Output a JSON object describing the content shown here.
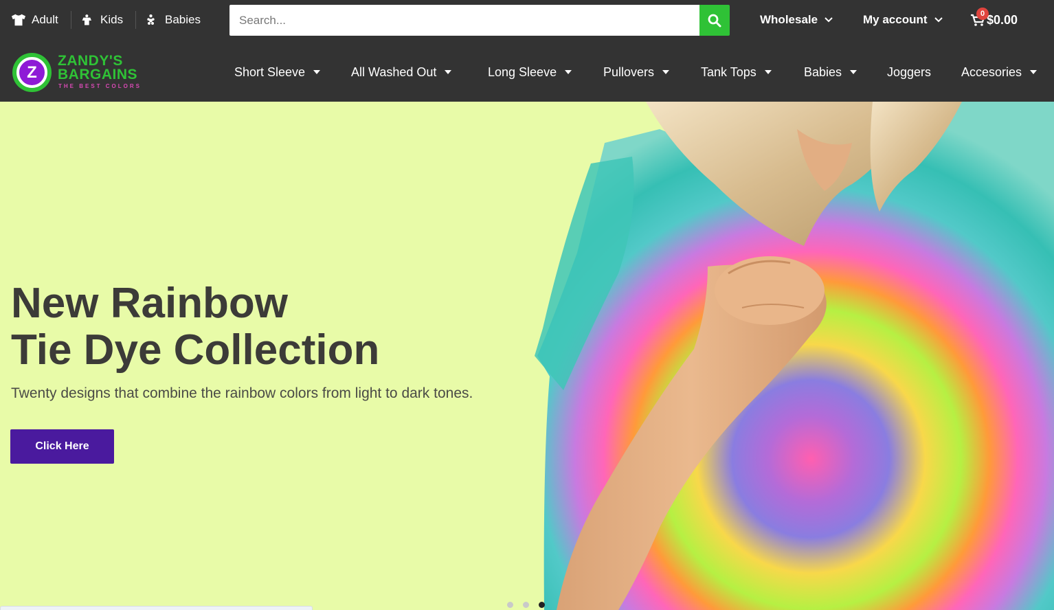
{
  "topbar": {
    "audience": [
      {
        "label": "Adult",
        "icon": "tshirt-icon"
      },
      {
        "label": "Kids",
        "icon": "kid-icon"
      },
      {
        "label": "Babies",
        "icon": "baby-icon"
      }
    ],
    "search": {
      "placeholder": "Search...",
      "value": ""
    },
    "links": [
      {
        "label": "Wholesale"
      },
      {
        "label": "My account"
      }
    ],
    "cart": {
      "count": "0",
      "total": "$0.00"
    }
  },
  "logo": {
    "line1": "ZANDY'S",
    "line2": "BARGAINS",
    "tagline": "THE BEST COLORS",
    "letter": "Z"
  },
  "nav": [
    {
      "label": "Short Sleeve",
      "dropdown": true
    },
    {
      "label": "All Washed Out",
      "dropdown": true
    },
    {
      "label": "Long Sleeve",
      "dropdown": true
    },
    {
      "label": "Pullovers",
      "dropdown": true
    },
    {
      "label": "Tank Tops",
      "dropdown": true
    },
    {
      "label": "Babies",
      "dropdown": true
    },
    {
      "label": "Joggers",
      "dropdown": false
    },
    {
      "label": "Accesories",
      "dropdown": true
    }
  ],
  "hero": {
    "title_line1": "New Rainbow",
    "title_line2": "Tie Dye Collection",
    "subtitle": "Twenty designs that combine the rainbow colors from light to dark tones.",
    "button": "Click Here",
    "slides": 3,
    "active_slide": 3
  },
  "colors": {
    "bar": "#333333",
    "accent_green": "#2fc236",
    "button_purple": "#4a1a9e",
    "hero_bg": "#e8fba8"
  }
}
